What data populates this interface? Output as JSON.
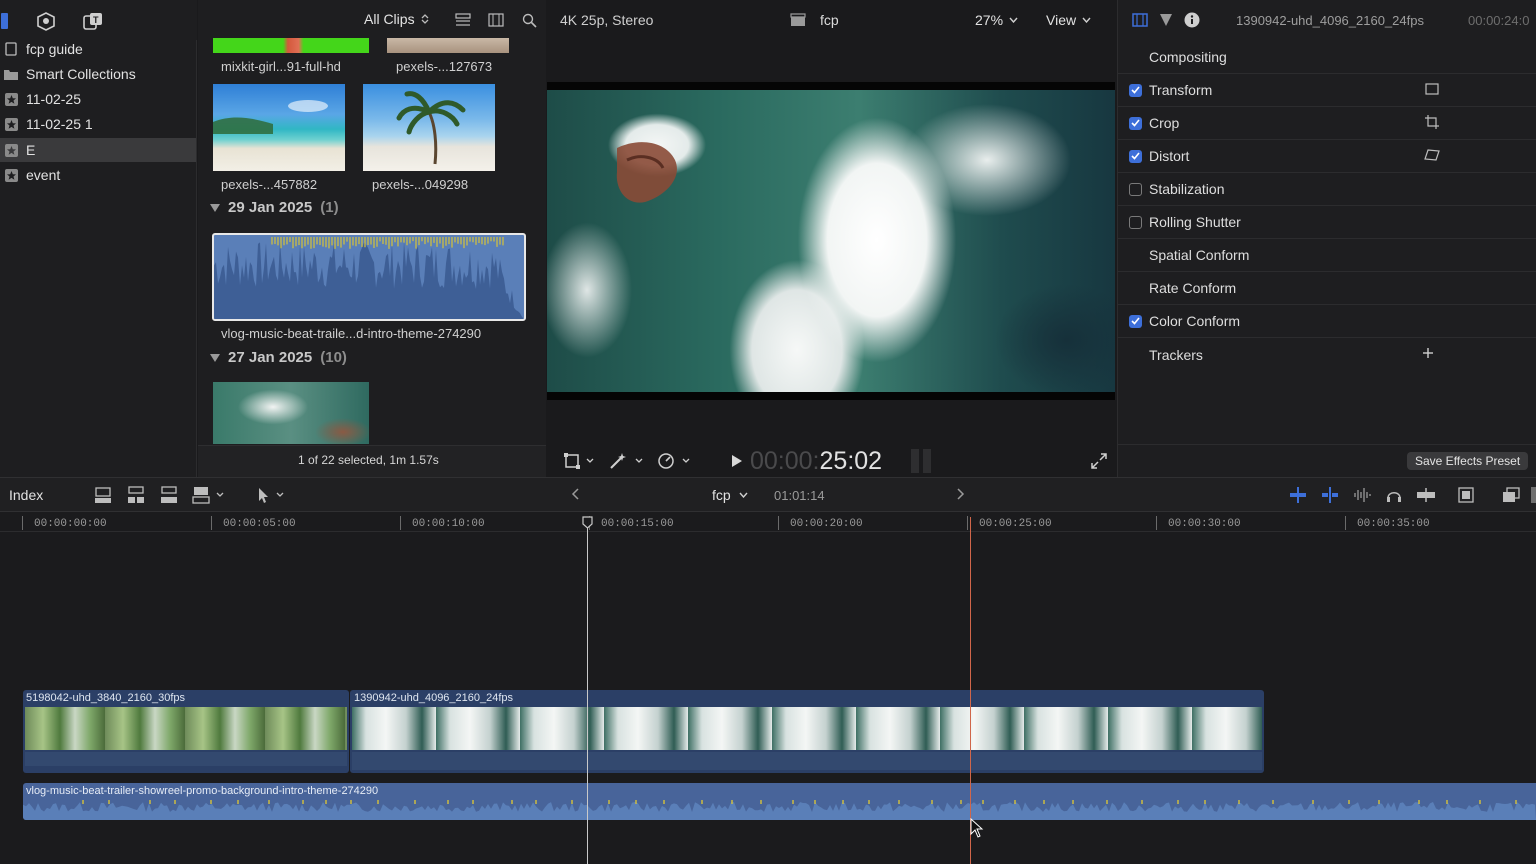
{
  "sidebar": {
    "items": [
      {
        "label": "fcp guide",
        "icon": "library-icon"
      },
      {
        "label": "Smart Collections",
        "icon": "folder-icon"
      },
      {
        "label": "11-02-25",
        "icon": "event-star-icon"
      },
      {
        "label": "11-02-25 1",
        "icon": "event-star-icon"
      },
      {
        "label": "E",
        "icon": "event-star-icon",
        "selected": true
      },
      {
        "label": "event",
        "icon": "event-star-icon"
      }
    ]
  },
  "browser": {
    "filter_label": "All Clips",
    "clips_top": [
      {
        "label": "mixkit-girl...91-full-hd"
      },
      {
        "label": "pexels-...127673"
      }
    ],
    "clips_row2": [
      {
        "label": "pexels-...457882"
      },
      {
        "label": "pexels-...049298"
      }
    ],
    "groups": [
      {
        "date": "29 Jan 2025",
        "count": "(1)"
      },
      {
        "date": "27 Jan 2025",
        "count": "(10)"
      }
    ],
    "audio_clip_label": "vlog-music-beat-traile...d-intro-theme-274290",
    "status": "1 of 22 selected, 1m 1.57s"
  },
  "viewer": {
    "format": "4K 25p, Stereo",
    "project": "fcp",
    "zoom": "27%",
    "view_label": "View",
    "timecode_dim": "00:00:",
    "timecode_bright": "25:02"
  },
  "inspector": {
    "clip_name": "1390942-uhd_4096_2160_24fps",
    "clip_time": "00:00:24:0",
    "sections": [
      {
        "label": "Compositing",
        "checkbox": "none"
      },
      {
        "label": "Transform",
        "checkbox": "on",
        "icon": "transform-onscreen-icon"
      },
      {
        "label": "Crop",
        "checkbox": "on",
        "icon": "crop-onscreen-icon"
      },
      {
        "label": "Distort",
        "checkbox": "on",
        "icon": "distort-onscreen-icon"
      },
      {
        "label": "Stabilization",
        "checkbox": "off"
      },
      {
        "label": "Rolling Shutter",
        "checkbox": "off"
      },
      {
        "label": "Spatial Conform",
        "checkbox": "none"
      },
      {
        "label": "Rate Conform",
        "checkbox": "none"
      },
      {
        "label": "Color Conform",
        "checkbox": "on"
      },
      {
        "label": "Trackers",
        "checkbox": "none",
        "icon": "add-icon"
      }
    ],
    "save_preset": "Save Effects Preset"
  },
  "timeline_bar": {
    "index_label": "Index",
    "project": "fcp",
    "duration": "01:01:14"
  },
  "ruler": {
    "labels": [
      "00:00:00:00",
      "00:00:05:00",
      "00:00:10:00",
      "00:00:15:00",
      "00:00:20:00",
      "00:00:25:00",
      "00:00:30:00",
      "00:00:35:00"
    ]
  },
  "timeline": {
    "clip1_name": "5198042-uhd_3840_2160_30fps",
    "clip2_name": "1390942-uhd_4096_2160_24fps",
    "audio_name": "vlog-music-beat-trailer-showreel-promo-background-intro-theme-274290"
  },
  "colors": {
    "accent": "#3d6fd9",
    "audio_clip": "#5a7fb8",
    "video_clip": "#2b3f66",
    "playhead": "#c9c9c9",
    "skimmer": "#d0664a"
  }
}
